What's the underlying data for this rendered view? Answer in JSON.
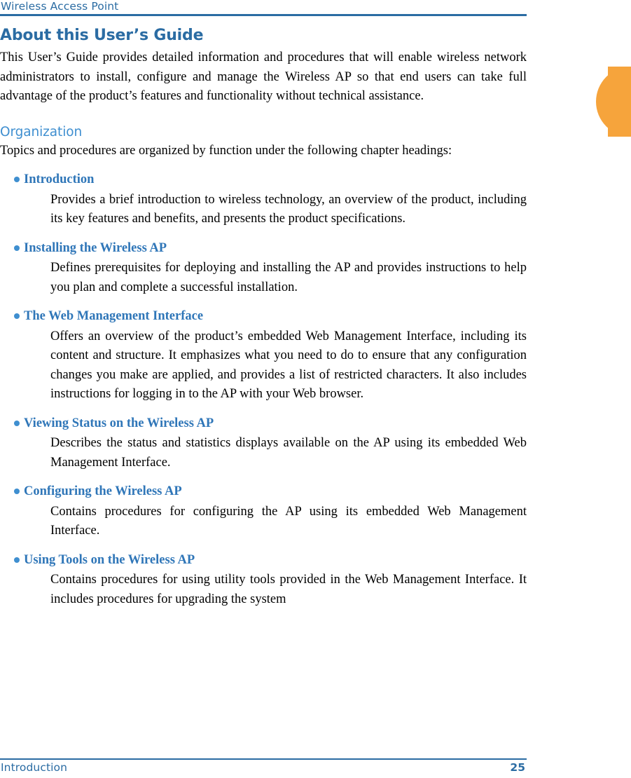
{
  "header": {
    "title": "Wireless Access Point"
  },
  "footer": {
    "chapter": "Introduction",
    "page_number": "25"
  },
  "colors": {
    "rule_blue": "#2b6ca3",
    "heading_blue": "#2b6ca3",
    "subheading_blue": "#3f8fd0",
    "bullet_title_blue": "#2f76b8",
    "tab_orange": "#f6a43c"
  },
  "main": {
    "h1": "About this User’s Guide",
    "intro_paragraph": "This User’s Guide provides detailed information and procedures that will enable wireless network administrators to install, configure and manage the Wireless AP so that end users can take full advantage of the product’s features and functionality without technical assistance.",
    "h2": "Organization",
    "organization_paragraph": "Topics and procedures are organized by function under the following chapter headings:",
    "bullets": [
      {
        "title": "Introduction",
        "body": "Provides a brief introduction to wireless technology, an overview of the product, including its key features and benefits, and presents the product specifications."
      },
      {
        "title": "Installing the Wireless AP",
        "body": "Defines prerequisites for deploying and installing the AP and provides instructions to help you plan and complete a successful installation."
      },
      {
        "title": "The Web Management Interface",
        "body": "Offers an overview of the product’s embedded Web Management Interface, including its content and structure. It emphasizes what you need to do to ensure that any configuration changes you make are applied, and provides a list of restricted characters. It also includes instructions for logging in to the AP with your Web browser."
      },
      {
        "title": "Viewing Status on the Wireless AP",
        "body": "Describes the status and statistics displays available on the AP using its embedded Web Management Interface."
      },
      {
        "title": "Configuring the Wireless AP",
        "body": "Contains procedures for configuring the AP using its embedded Web Management Interface."
      },
      {
        "title": "Using Tools on the Wireless AP",
        "body": "Contains procedures for using utility tools provided in the Web Management Interface. It includes procedures for upgrading the system"
      }
    ]
  }
}
